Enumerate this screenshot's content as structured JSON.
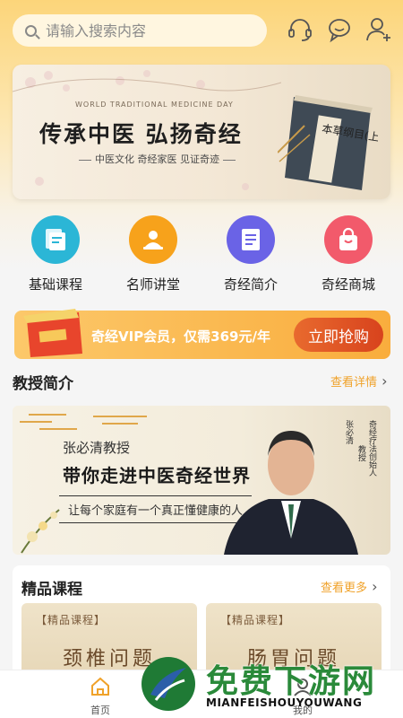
{
  "header": {
    "search_placeholder": "请输入搜索内容",
    "icons": [
      "headset-icon",
      "chat-icon",
      "add-user-icon"
    ]
  },
  "banner": {
    "en_line": "WORLD TRADITIONAL MEDICINE DAY",
    "title": "传承中医  弘扬奇经",
    "subtitle": "中医文化 奇经家医 见证奇迹",
    "book_text": "本草纲目(上)"
  },
  "nav": {
    "items": [
      {
        "label": "基础课程",
        "icon": "document-icon",
        "color": "#2bb6d6"
      },
      {
        "label": "名师讲堂",
        "icon": "teacher-icon",
        "color": "#f7a21b"
      },
      {
        "label": "奇经简介",
        "icon": "list-icon",
        "color": "#6a63e6"
      },
      {
        "label": "奇经商城",
        "icon": "shopping-bag-icon",
        "color": "#f25a6b"
      }
    ]
  },
  "vip": {
    "text": "奇经VIP会员，仅需369元/年",
    "button": "立即抢购"
  },
  "professor_section": {
    "title": "教授简介",
    "more": "查看详情",
    "name": "张必清教授",
    "headline": "带你走进中医奇经世界",
    "slogan": "让每个家庭有一个真正懂健康的人",
    "vertical_1": "张必清",
    "vertical_2": "奇经疗法创始人",
    "vertical_3": "教授"
  },
  "courses_section": {
    "title": "精品课程",
    "more": "查看更多",
    "cards": [
      {
        "tag": "【精品课程】",
        "name": "颈椎问题"
      },
      {
        "tag": "【精品课程】",
        "name": "肠胃问题"
      }
    ]
  },
  "tabbar": {
    "home": "首页",
    "second": "我的"
  },
  "watermark": {
    "text": "免费下游网",
    "sub": "MIANFEISHOUYOUWANG"
  },
  "colors": {
    "accent": "#f9ad3d",
    "more_link": "#f0a22a",
    "watermark_green": "#2a8a3a"
  }
}
